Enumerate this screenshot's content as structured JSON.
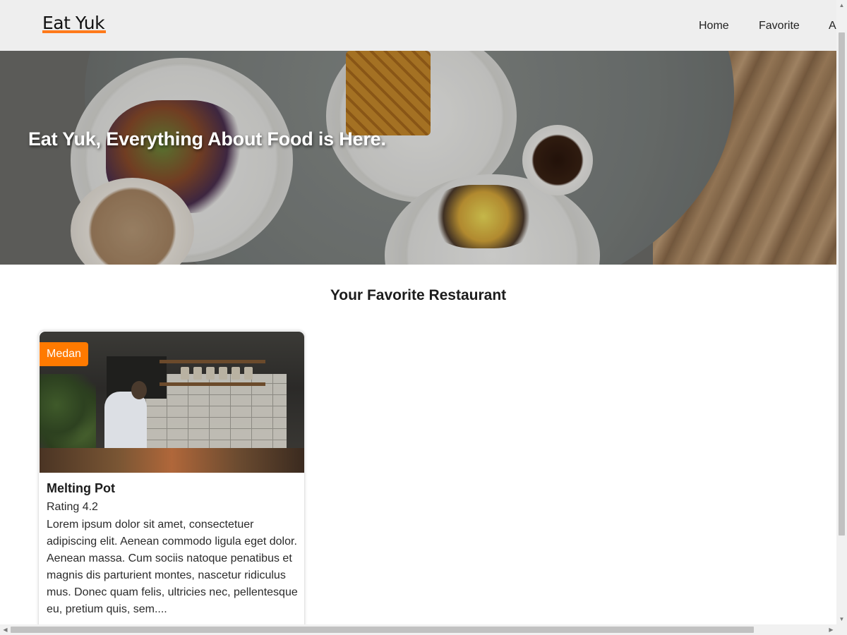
{
  "header": {
    "logo": "Eat Yuk",
    "nav": [
      "Home",
      "Favorite",
      "A"
    ]
  },
  "hero": {
    "title": "Eat Yuk, Everything About Food is Here."
  },
  "main": {
    "section_title": "Your Favorite Restaurant",
    "restaurants": [
      {
        "city": "Medan",
        "name": "Melting Pot",
        "rating": "Rating 4.2",
        "description": "Lorem ipsum dolor sit amet, consectetuer adipiscing elit. Aenean commodo ligula eget dolor. Aenean massa. Cum sociis natoque penatibus et magnis dis parturient montes, nascetur ridiculus mus. Donec quam felis, ultricies nec, pellentesque eu, pretium quis, sem...."
      }
    ]
  },
  "colors": {
    "accent": "#ff7a00",
    "header_bg": "#eeeeee"
  },
  "scrollbars": {
    "up_arrow": "▲",
    "down_arrow": "▼",
    "left_arrow": "◀",
    "right_arrow": "▶"
  }
}
